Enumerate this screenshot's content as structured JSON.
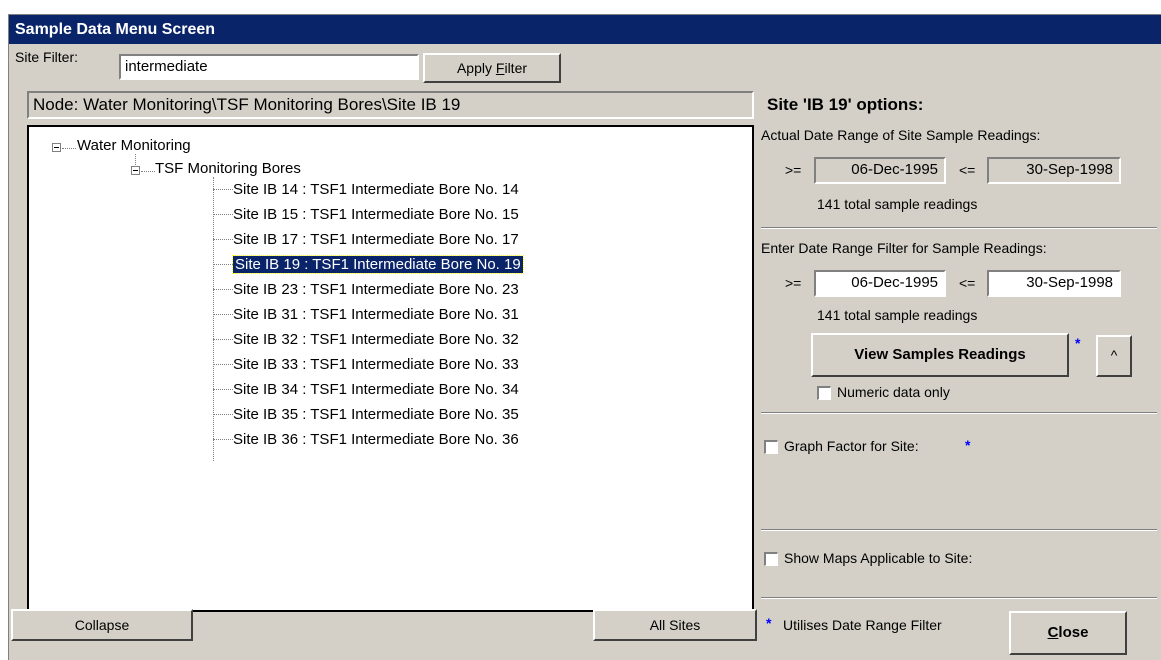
{
  "window": {
    "title": "Sample Data Menu Screen"
  },
  "filter": {
    "label": "Site Filter:",
    "value": "intermediate",
    "apply_pre": "Apply ",
    "apply_ul": "F",
    "apply_post": "ilter"
  },
  "node_path": "Node: Water Monitoring\\TSF Monitoring Bores\\Site IB 19",
  "tree": {
    "root": "Water Monitoring",
    "group": "TSF Monitoring Bores",
    "items": [
      "Site IB 14 : TSF1 Intermediate Bore No. 14",
      "Site IB 15 : TSF1 Intermediate Bore No. 15",
      "Site IB 17 : TSF1 Intermediate Bore No. 17",
      "Site IB 19 : TSF1 Intermediate Bore No. 19",
      "Site IB 23 : TSF1 Intermediate Bore No. 23",
      "Site IB 31 : TSF1 Intermediate Bore No. 31",
      "Site IB 32 : TSF1 Intermediate Bore No. 32",
      "Site IB 33 : TSF1 Intermediate Bore No. 33",
      "Site IB 34 : TSF1 Intermediate Bore No. 34",
      "Site IB 35 : TSF1 Intermediate Bore No. 35",
      "Site IB 36 : TSF1 Intermediate Bore No. 36"
    ],
    "selected_index": 3
  },
  "options": {
    "heading": "Site 'IB 19' options:",
    "actual_label": "Actual Date Range of Site Sample Readings:",
    "ge": ">=",
    "le": "<=",
    "actual_from": "06-Dec-1995",
    "actual_to": "30-Sep-1998",
    "actual_count": "141 total sample readings",
    "filter_label": "Enter Date Range Filter for Sample Readings:",
    "filter_from": "06-Dec-1995",
    "filter_to": "30-Sep-1998",
    "filter_count": "141 total sample readings",
    "view_button": "View Samples Readings",
    "star": "*",
    "caret_button": "^",
    "numeric_only": "Numeric data only",
    "graph_factor": "Graph Factor for Site:",
    "show_maps": "Show Maps Applicable to Site:",
    "note": "Utilises Date Range Filter"
  },
  "buttons": {
    "collapse": "Collapse",
    "all_sites": "All Sites",
    "close_ul": "C",
    "close_rest": "lose"
  }
}
